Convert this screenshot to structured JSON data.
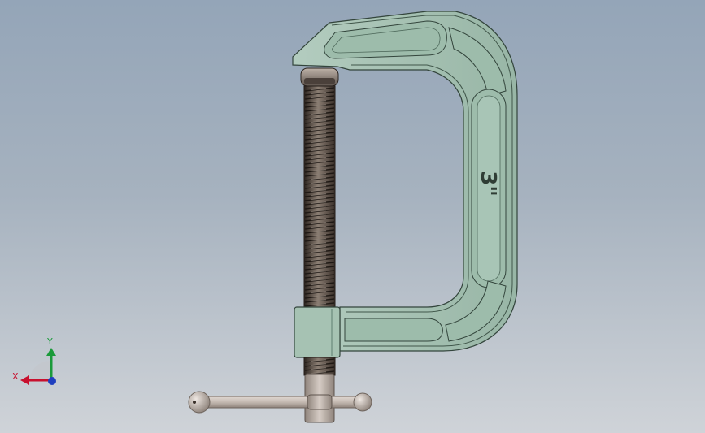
{
  "model": {
    "frame_marking": "3\"",
    "colors": {
      "frame": "#a6c2b3",
      "frame_dark": "#5f7f70",
      "frame_edge": "#33453c",
      "screw": "#6d6259",
      "screw_dark": "#2c241f",
      "handle": "#c9bfb8",
      "handle_shade": "#8e837b",
      "background_top": "#94a5b8",
      "background_bottom": "#cfd3d8"
    }
  },
  "triad": {
    "x_label": "X",
    "y_label": "Y",
    "x_color": "#c8102e",
    "y_color": "#1a9a3a",
    "z_color": "#1f3fbf"
  }
}
